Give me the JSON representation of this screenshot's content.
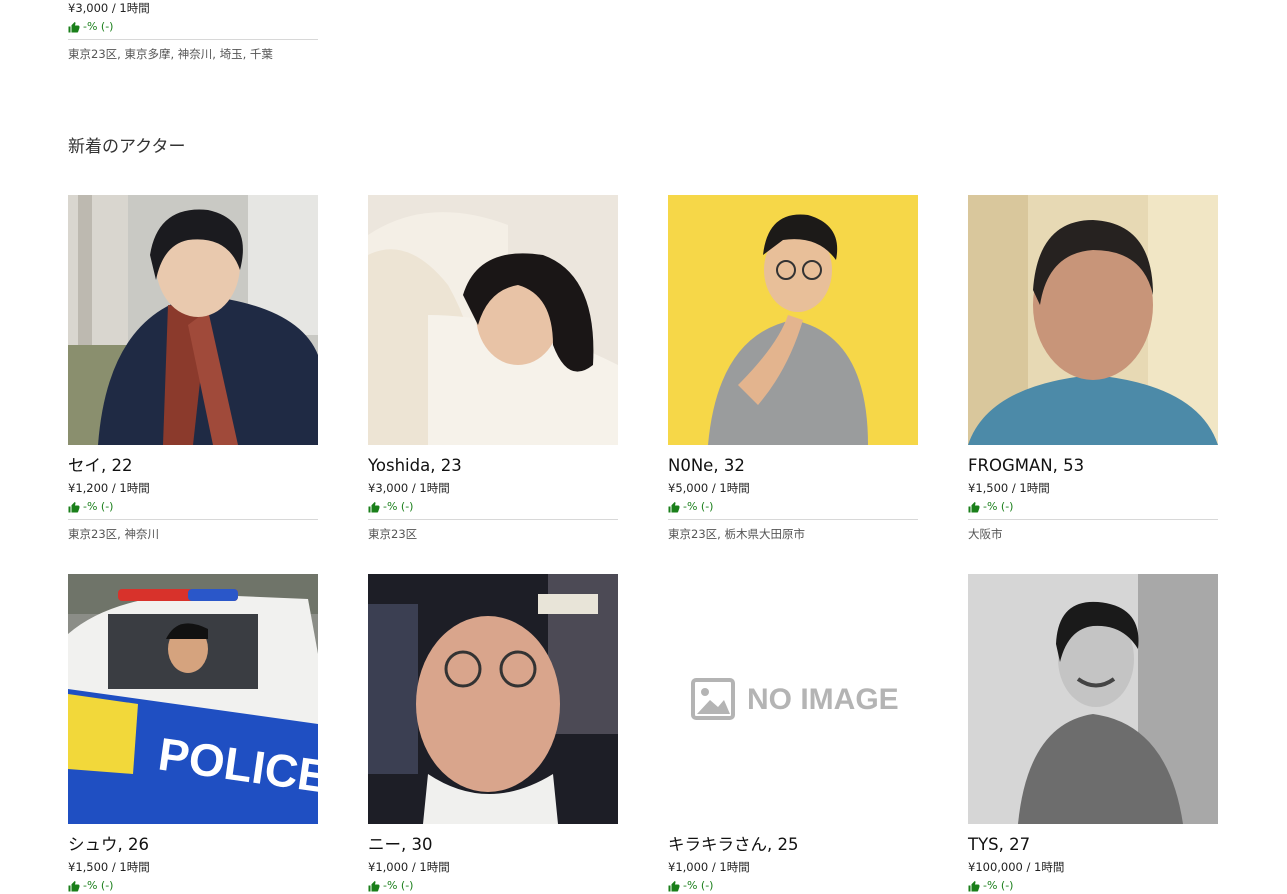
{
  "top_card": {
    "price": "¥3,000 / 1時間",
    "rating": "-% (-)",
    "area": "東京23区, 東京多摩, 神奈川, 埼玉, 千葉"
  },
  "section": {
    "title": "新着のアクター"
  },
  "actors": [
    {
      "name": "セイ, 22",
      "price": "¥1,200 / 1時間",
      "rating": "-% (-)",
      "area": "東京23区, 神奈川"
    },
    {
      "name": "Yoshida, 23",
      "price": "¥3,000 / 1時間",
      "rating": "-% (-)",
      "area": "東京23区"
    },
    {
      "name": "N0Ne, 32",
      "price": "¥5,000 / 1時間",
      "rating": "-% (-)",
      "area": "東京23区, 栃木県大田原市"
    },
    {
      "name": "FROGMAN, 53",
      "price": "¥1,500 / 1時間",
      "rating": "-% (-)",
      "area": "大阪市"
    },
    {
      "name": "シュウ, 26",
      "price": "¥1,500 / 1時間",
      "rating": "-% (-)"
    },
    {
      "name": "ニー, 30",
      "price": "¥1,000 / 1時間",
      "rating": "-% (-)"
    },
    {
      "name": "キラキラさん, 25",
      "price": "¥1,000 / 1時間",
      "rating": "-% (-)",
      "placeholder_text": "NO IMAGE"
    },
    {
      "name": "TYS, 27",
      "price": "¥100,000 / 1時間",
      "rating": "-% (-)"
    }
  ],
  "colors": {
    "rating_green": "#1a7f1a",
    "divider": "#d8d8d8"
  },
  "icons": {
    "rating": "thumbs-up-icon"
  }
}
